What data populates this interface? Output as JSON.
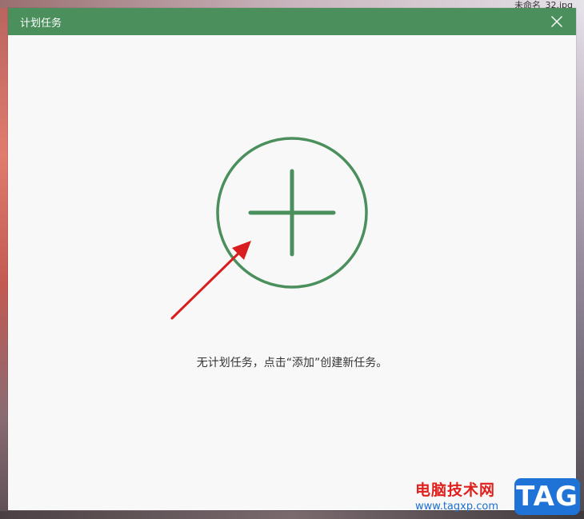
{
  "dialog": {
    "title": "计划任务",
    "close_icon": "close-icon",
    "add_icon": "plus-circle-icon",
    "empty_message": "无计划任务，点击“添加”创建新任务。"
  },
  "background": {
    "top_text": "未命名_32.jpg"
  },
  "watermark": {
    "site_name": "电脑技术网",
    "url": "www.tagxp.com",
    "badge": "TAG"
  },
  "colors": {
    "titlebar": "#4a8f5c",
    "accent_green": "#4a8f5c",
    "arrow_red": "#d81e1e",
    "watermark_red": "#e0201d",
    "watermark_blue": "#1f73d6"
  }
}
